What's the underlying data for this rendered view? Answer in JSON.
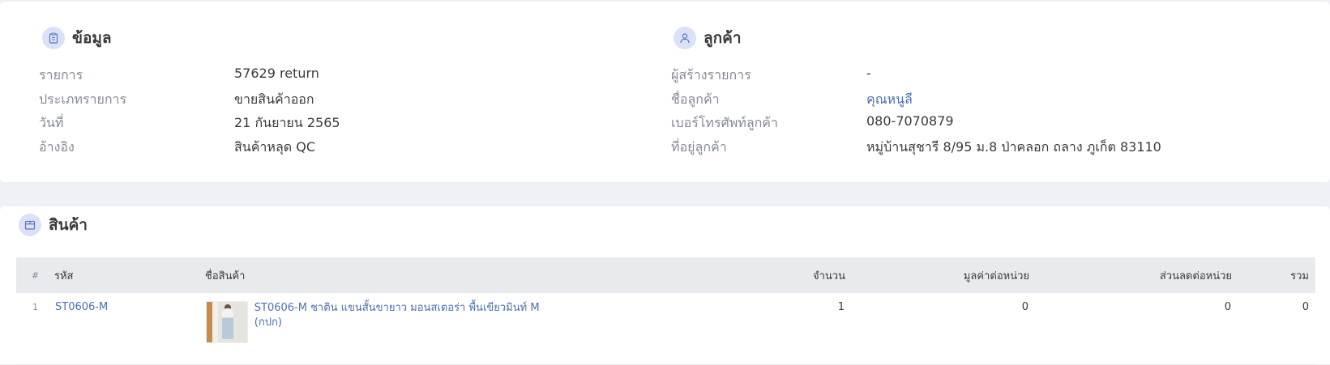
{
  "info": {
    "title": "ข้อมูล",
    "rows": [
      {
        "label": "รายการ",
        "value": "57629 return"
      },
      {
        "label": "ประเภทรายการ",
        "value": "ขายสินค้าออก"
      },
      {
        "label": "วันที่",
        "value": "21 กันยายน 2565"
      },
      {
        "label": "อ้างอิง",
        "value": "สินค้าหลุด QC"
      }
    ]
  },
  "customer": {
    "title": "ลูกค้า",
    "rows": [
      {
        "label": "ผู้สร้างรายการ",
        "value": "-"
      },
      {
        "label": "ชื่อลูกค้า",
        "value": "คุณหนูลี"
      },
      {
        "label": "เบอร์โทรศัพท์ลูกค้า",
        "value": "080-7070879"
      },
      {
        "label": "ที่อยู่ลูกค้า",
        "value": "หมู่บ้านสุชารี 8/95 ม.8 ป่าคลอก ถลาง ภูเก็ต 83110"
      }
    ]
  },
  "products": {
    "title": "สินค้า",
    "columns": {
      "index": "#",
      "code": "รหัส",
      "name": "ชื่อสินค้า",
      "qty": "จำนวน",
      "unit_price": "มูลค่าต่อหน่วย",
      "unit_discount": "ส่วนลดต่อหน่วย",
      "total": "รวม"
    },
    "items": [
      {
        "index": "1",
        "code": "ST0606-M",
        "name": "ST0606-M ชาติน แขนสั้นขายาว มอนสเตอร่า พื้นเขียวมินท์ M (กปก)",
        "qty": "1",
        "unit_price": "0",
        "unit_discount": "0",
        "total": "0"
      }
    ]
  },
  "icons": {
    "info": "clipboard-icon",
    "customer": "user-icon",
    "products": "box-icon"
  },
  "colors": {
    "background": "#eff1f7",
    "accent_circle": "#dbe2f8",
    "link": "#4a6fb0",
    "table_header": "#e8eaee"
  }
}
